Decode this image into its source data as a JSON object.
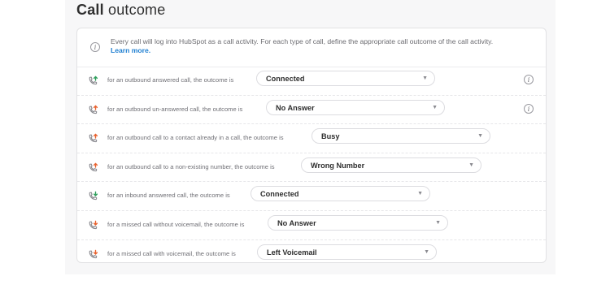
{
  "header": {
    "title_bold": "Call",
    "title_rest": "outcome"
  },
  "info": {
    "text": "Every call will log into HubSpot as a call activity. For each type of call, define the appropriate call outcome of the call activity.",
    "link": "Learn more."
  },
  "rows": [
    {
      "label": "for an outbound answered call, the outcome is",
      "value": "Connected",
      "direction": "outbound",
      "color": "#2e9e5b"
    },
    {
      "label": "for an outbound un-answered call, the outcome is",
      "value": "No Answer",
      "direction": "outbound",
      "color": "#e8622f"
    },
    {
      "label": "for an outbound call to a contact already in a call, the outcome is",
      "value": "Busy",
      "direction": "outbound",
      "color": "#e8622f"
    },
    {
      "label": "for an outbound call to a non-existing number, the outcome is",
      "value": "Wrong Number",
      "direction": "outbound",
      "color": "#e8622f"
    },
    {
      "label": "for an inbound answered call, the outcome is",
      "value": "Connected",
      "direction": "inbound",
      "color": "#2e9e5b"
    },
    {
      "label": "for a missed call without voicemail, the outcome is",
      "value": "No Answer",
      "direction": "inbound",
      "color": "#e8622f"
    },
    {
      "label": "for a missed call with voicemail, the outcome is",
      "value": "Left Voicemail",
      "direction": "inbound",
      "color": "#e8622f"
    }
  ],
  "colors": {
    "link": "#1f7fd1",
    "phone": "#8a8a90"
  }
}
